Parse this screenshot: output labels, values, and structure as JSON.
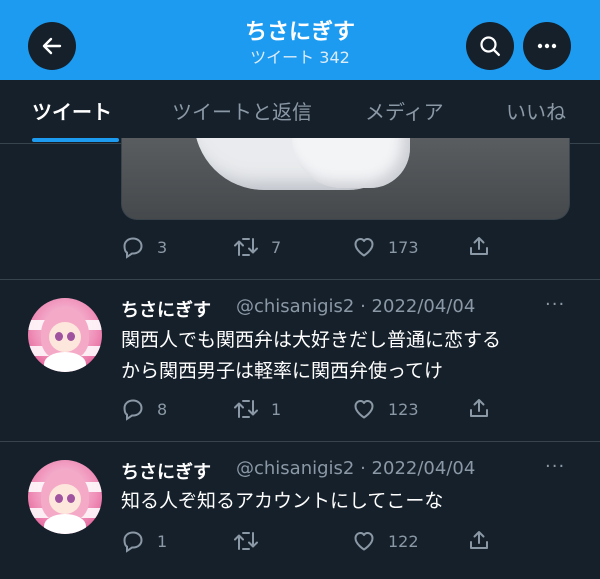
{
  "header": {
    "title": "ちさにぎす",
    "subtitle": "ツイート 342"
  },
  "tabs": [
    {
      "label": "ツイート",
      "active": true
    },
    {
      "label": "ツイートと返信",
      "active": false
    },
    {
      "label": "メディア",
      "active": false
    },
    {
      "label": "いいね",
      "active": false
    }
  ],
  "media_tweet": {
    "replies": "3",
    "retweets": "7",
    "likes": "173"
  },
  "tweets": [
    {
      "name": "ちさにぎす",
      "handle_date": "@chisanigis2 · 2022/04/04",
      "text_lines": [
        "関西人でも関西弁は大好きだし普通に恋する",
        "から関西男子は軽率に関西弁使ってけ"
      ],
      "replies": "8",
      "retweets": "1",
      "likes": "123"
    },
    {
      "name": "ちさにぎす",
      "handle_date": "@chisanigis2 · 2022/04/04",
      "text_lines": [
        "知る人ぞ知るアカウントにしてこーな"
      ],
      "replies": "1",
      "retweets": "",
      "likes": "122"
    }
  ],
  "more_glyph": "···",
  "colors": {
    "header_bg": "#1d9bf0",
    "bg": "#15202b",
    "muted": "#8b98a5",
    "accent": "#1d9bf0"
  }
}
